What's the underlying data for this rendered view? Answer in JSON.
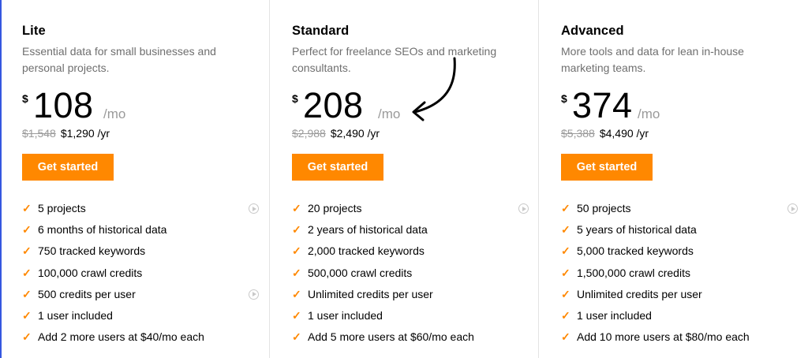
{
  "plans": [
    {
      "name": "Lite",
      "description": "Essential data for small businesses and personal projects.",
      "currency": "$",
      "amount": "108",
      "period": "/mo",
      "old_yearly": "$1,548",
      "yearly": "$1,290 /yr",
      "cta": "Get started",
      "features": [
        "5 projects",
        "6 months of historical data",
        "750 tracked keywords",
        "100,000 crawl credits",
        "500 credits per user",
        "1 user included",
        "Add 2 more users at $40/mo each"
      ]
    },
    {
      "name": "Standard",
      "description": "Perfect for freelance SEOs and marketing consultants.",
      "currency": "$",
      "amount": "208",
      "period": "/mo",
      "old_yearly": "$2,988",
      "yearly": "$2,490 /yr",
      "cta": "Get started",
      "features": [
        "20 projects",
        "2 years of historical data",
        "2,000 tracked keywords",
        "500,000 crawl credits",
        "Unlimited credits per user",
        "1 user included",
        "Add 5 more users at $60/mo each"
      ]
    },
    {
      "name": "Advanced",
      "description": "More tools and data for lean in-house marketing teams.",
      "currency": "$",
      "amount": "374",
      "period": "/mo",
      "old_yearly": "$5,388",
      "yearly": "$4,490 /yr",
      "cta": "Get started",
      "features": [
        "50 projects",
        "5 years of historical data",
        "5,000 tracked keywords",
        "1,500,000 crawl credits",
        "Unlimited credits per user",
        "1 user included",
        "Add 10 more users at $80/mo each"
      ]
    }
  ],
  "icons": {
    "check": "check-icon",
    "play": "play-circle-icon",
    "annotation": "hand-drawn-arrow-icon"
  },
  "colors": {
    "accent": "#ff8800",
    "muted_text": "#6f6f6f",
    "strike_text": "#9a9a9a",
    "divider": "#e3e3e3"
  }
}
